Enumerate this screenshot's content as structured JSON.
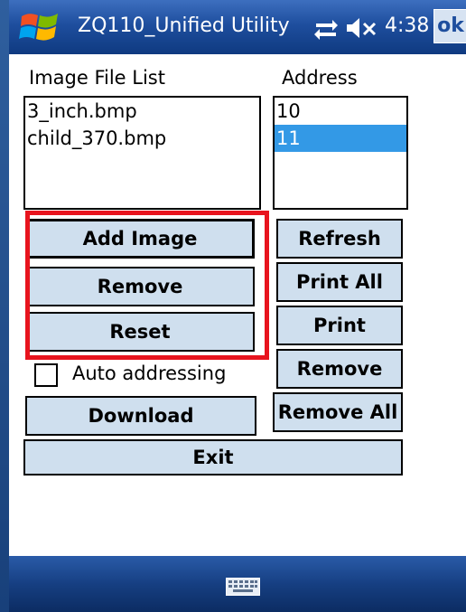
{
  "titlebar": {
    "title": "ZQ110_Unified Utility",
    "clock": "4:38",
    "ok_label": "ok"
  },
  "image_list": {
    "label": "Image File List",
    "items": [
      "3_inch.bmp",
      "child_370.bmp"
    ]
  },
  "address_list": {
    "label": "Address",
    "items": [
      "10",
      "11"
    ],
    "selected_index": 1
  },
  "buttons": {
    "add_image": "Add Image",
    "remove_left": "Remove",
    "reset": "Reset",
    "download": "Download",
    "exit": "Exit",
    "refresh": "Refresh",
    "print_all": "Print All",
    "print": "Print",
    "remove_right": "Remove",
    "remove_all": "Remove All"
  },
  "auto_addressing": {
    "label": "Auto addressing",
    "checked": false
  },
  "colors": {
    "highlight_box": "#e8141e",
    "selection": "#3399e6",
    "button_face": "#cfdfee"
  }
}
